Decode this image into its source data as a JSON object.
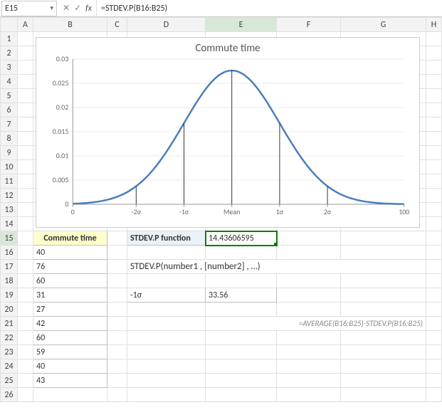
{
  "formula_bar": {
    "cell_ref": "E15",
    "formula": "=STDEV.P(B16:B25)"
  },
  "columns": [
    "A",
    "B",
    "C",
    "D",
    "E",
    "F",
    "G",
    "H"
  ],
  "row_count": 26,
  "commute_header": "Commute time",
  "commute_values": [
    "40",
    "76",
    "60",
    "31",
    "27",
    "42",
    "60",
    "59",
    "40",
    "43"
  ],
  "func_label": "STDEV.P function",
  "func_result": "14.43606595",
  "syntax": "STDEV.P(number1 , [number2] , …)",
  "sigma_label": "-1σ",
  "sigma_value": "33.56",
  "formula_example": "=AVERAGE(B16:B25)-STDEV.P(B16:B25)",
  "chart_data": {
    "type": "line",
    "title": "Commute time",
    "xlabel": "",
    "ylabel": "",
    "xlim": [
      0,
      100
    ],
    "ylim": [
      0,
      0.03
    ],
    "yticks": [
      0,
      0.005,
      0.01,
      0.015,
      0.02,
      0.025,
      0.03
    ],
    "xticks_values": [
      0,
      19.13,
      33.56,
      48,
      62.44,
      76.87,
      100
    ],
    "xticks_labels": [
      "0",
      "-2σ",
      "-1σ",
      "Mean",
      "1σ",
      "2σ",
      "100"
    ],
    "mean": 48,
    "stdev": 14.436,
    "peak": 0.0276,
    "sigma_markers": [
      {
        "pos": 19.13,
        "label": "-2σ",
        "y": 0.00374
      },
      {
        "pos": 33.56,
        "label": "-1σ",
        "y": 0.01676
      },
      {
        "pos": 48,
        "label": "Mean",
        "y": 0.02764
      },
      {
        "pos": 62.44,
        "label": "1σ",
        "y": 0.01676
      },
      {
        "pos": 76.87,
        "label": "2σ",
        "y": 0.00374
      }
    ]
  }
}
